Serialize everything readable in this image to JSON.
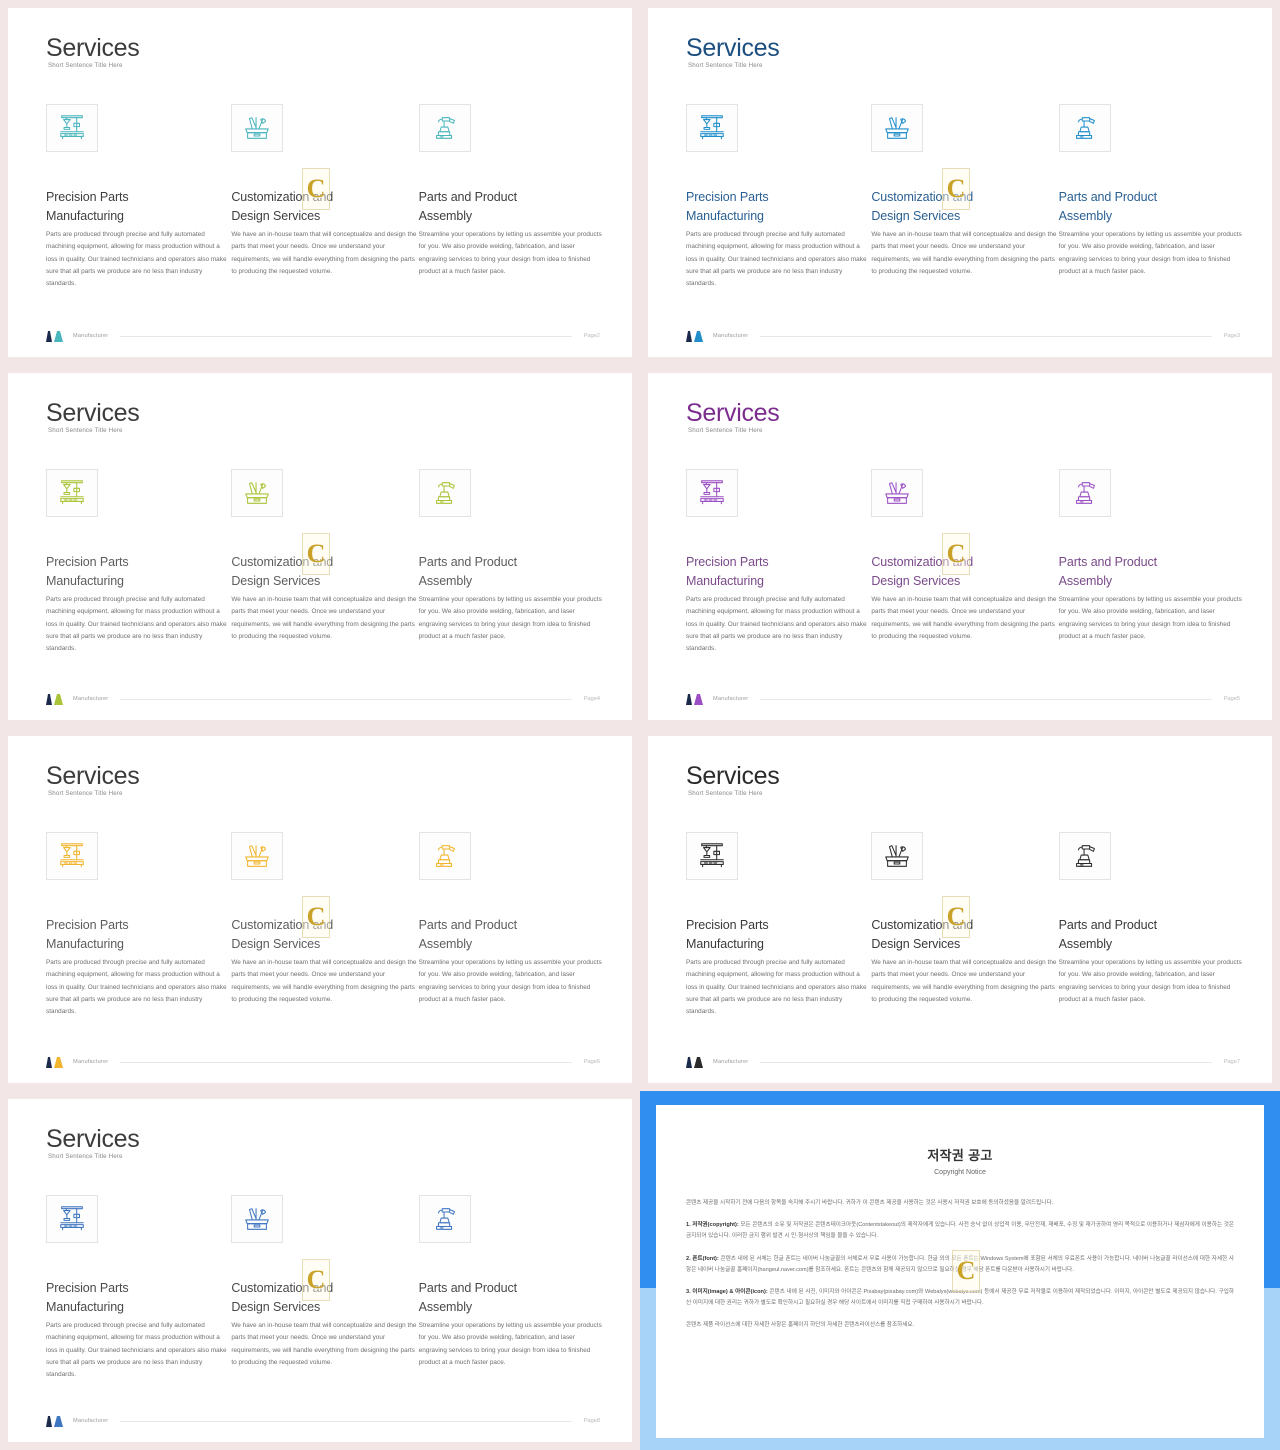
{
  "slide_common": {
    "title": "Services",
    "subtitle": "Short Sentence Title Here",
    "logo_text": "Manufacturer",
    "columns": [
      {
        "icon": "drill-press-icon",
        "heading": "Precision Parts\nManufacturing",
        "body": "Parts are produced through precise and fully automated machining  equipment, allowing  for mass production without a loss in quality.  Our trained technicians and operators also make sure that all parts we produce are no less than industry standards."
      },
      {
        "icon": "toolbox-icon",
        "heading": "Customization and\nDesign Services",
        "body": "We have an in-house  team that will conceptualize and design the parts that meet your needs. Once we understand your requirements,  we will handle everything from  designing  the parts to producing the requested volume."
      },
      {
        "icon": "robot-arm-icon",
        "heading": "Parts and  Product\nAssembly",
        "body": "Streamline your operations by letting us assemble your products for you. We also  provide welding, fabrication,  and laser engraving services to bring your design from idea to finished  product at a much faster pace."
      }
    ]
  },
  "slides": [
    {
      "page": "Page2",
      "accent": "#49b5bd",
      "title_color": "#3c3c3c",
      "heading_color": "#3f3f3f"
    },
    {
      "page": "Page3",
      "accent": "#1f8ecb",
      "title_color": "#1c4e80",
      "heading_color": "#2a5f92"
    },
    {
      "page": "Page4",
      "accent": "#a9c437",
      "title_color": "#3c3c3c",
      "heading_color": "#5d5d5d"
    },
    {
      "page": "Page5",
      "accent": "#9b4fc4",
      "title_color": "#7b2d8e",
      "heading_color": "#7a4a8a"
    },
    {
      "page": "Page6",
      "accent": "#f2b52e",
      "title_color": "#3c3c3c",
      "heading_color": "#5d5d5d"
    },
    {
      "page": "Page7",
      "accent": "#2b2b2b",
      "title_color": "#2b2b2b",
      "heading_color": "#3a3a3a"
    },
    {
      "page": "Page8",
      "accent": "#3f76c0",
      "title_color": "#3c3c3c",
      "heading_color": "#4a4a4a"
    }
  ],
  "watermark": {
    "glyph": "C"
  },
  "copyright": {
    "title": "저작권 공고",
    "subtitle": "Copyright Notice",
    "intro": "콘텐츠 제공을 시작하기 전에 다음의 항목을 숙지해 주시기 바랍니다. 귀하가 이 콘텐츠 제공을 사용하는 것은 사용시 저작권 보호에 동의하셨음을 알려드립니다.",
    "items": [
      {
        "label": "1. 저작권(copyright):",
        "text": "모든 콘텐츠의 소유 및 저작권은 콘텐츠테이크아웃(Contentstakeout)의 제작자에게 있습니다. 사전 승낙 없이 상업적 이용, 무단전재, 재배포, 수정 및 재가공하여 영리 목적으로 이용하거나 제삼자에게 이용하는 것은 금지되어 있습니다. 이러한 금지 행위 발견 시 민·형사상의 책임을 물을 수 있습니다."
      },
      {
        "label": "2. 폰트(font):",
        "text": "콘텐츠 내에 된 서체는 한글 폰트는 네이버 나눔글꼴의 서체로서 무료 사용이 가능합니다. 한글 외의 모든 폰트는 Windows System에 포함된 서체의 무료폰트 사용이 가능합니다. 네이버 나눔글꼴 라이선스에 대한 자세한 사항은 네이버 나눔글꼴 홈페이지(hangeul.naver.com)를 참조하세요. 폰트는 콘텐츠와 함께 제공되지 않으므로 필요하실 경우 해당 폰트를 다운받아 사용하시기 바랍니다."
      },
      {
        "label": "3. 이미지(image) & 아이콘(icon):",
        "text": "콘텐츠 내에 된 사진, 이미지와 아이콘은 Pixabay(pixabay.com)와 Webalys(webalys.com) 등에서 제공한 무료 저작물로 이용하여 제작되었습니다. 이미지, 아이콘만 별도로 제공되지 않습니다. 구입하신 이미지에 대한 권리는 귀하가 별도로 확인하시고 필요하실 경우 해당 사이트에서 이미지를 직접 구매하여 사용하시기 바랍니다."
      }
    ],
    "outro": "콘텐츠 제품 라이선스에 대한 자세한 사항은 홈페이지 하단의 자세한 콘텐츠라이선스를 참조하세요."
  }
}
